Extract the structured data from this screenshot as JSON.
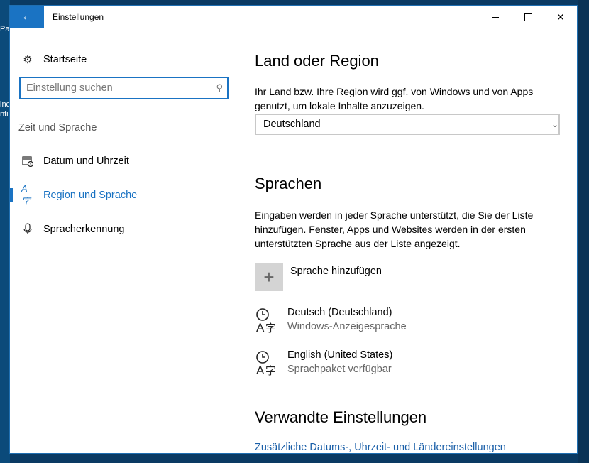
{
  "window": {
    "title": "Einstellungen"
  },
  "desktop": {
    "texts": [
      "Pa",
      "inc",
      "ntia"
    ]
  },
  "sidebar": {
    "home": "Startseite",
    "search_placeholder": "Einstellung suchen",
    "section": "Zeit und Sprache",
    "items": [
      {
        "label": "Datum und Uhrzeit",
        "icon": "calendar-clock-icon"
      },
      {
        "label": "Region und Sprache",
        "icon": "language-icon",
        "active": true
      },
      {
        "label": "Spracherkennung",
        "icon": "microphone-icon"
      }
    ]
  },
  "region": {
    "title": "Land oder Region",
    "description": "Ihr Land bzw. Ihre Region wird ggf. von Windows und von Apps genutzt, um lokale Inhalte anzuzeigen.",
    "selected": "Deutschland"
  },
  "languages": {
    "title": "Sprachen",
    "description": "Eingaben werden in jeder Sprache unterstützt, die Sie der Liste hinzufügen. Fenster, Apps und Websites werden in der ersten unterstützten Sprache aus der Liste angezeigt.",
    "add_label": "Sprache hinzufügen",
    "list": [
      {
        "name": "Deutsch (Deutschland)",
        "status": "Windows-Anzeigesprache"
      },
      {
        "name": "English (United States)",
        "status": "Sprachpaket verfügbar"
      }
    ]
  },
  "related": {
    "title": "Verwandte Einstellungen",
    "link": "Zusätzliche Datums-, Uhrzeit- und Ländereinstellungen"
  },
  "colors": {
    "accent": "#1a73c3",
    "link": "#1a5fa8"
  }
}
